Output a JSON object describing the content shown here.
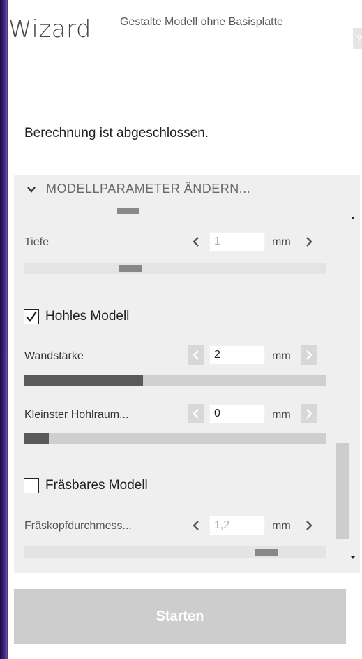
{
  "header": {
    "title": "Wizard",
    "subtitle": "Gestalte Modell ohne Basisplatte",
    "help_label": "?"
  },
  "status": "Berechnung ist abgeschlossen.",
  "group": {
    "title": "MODELLPARAMETER ÄNDERN..."
  },
  "params": {
    "tiefe": {
      "label": "Tiefe",
      "value": "1",
      "unit": "mm",
      "slider_level": 0.35,
      "enabled": false
    },
    "wandstaerke": {
      "label": "Wandstärke",
      "value": "2",
      "unit": "mm",
      "slider_level": 0.4,
      "enabled": true
    },
    "hohlraum": {
      "label": "Kleinster Hohlraum...",
      "value": "0",
      "unit": "mm",
      "slider_level": 0.08,
      "enabled": true
    },
    "fraeskopf": {
      "label": "Fräskopfdurchmess...",
      "value": "1,2",
      "unit": "mm",
      "slider_level": 0.8,
      "enabled": false
    }
  },
  "options": {
    "hohles_modell": {
      "label": "Hohles Modell",
      "checked": true
    },
    "fraesbares_modell": {
      "label": "Fräsbares Modell",
      "checked": false
    }
  },
  "start_button": {
    "label": "Starten",
    "enabled": false
  },
  "colors": {
    "group_bg": "#efefef",
    "disabled_button": "#cdcdcd",
    "slider_fill": "#5a5a5a"
  },
  "icons": [
    "chevron-down-icon",
    "chevron-left-icon",
    "chevron-right-icon",
    "checkmark-icon",
    "arrow-up-icon",
    "arrow-down-icon"
  ]
}
